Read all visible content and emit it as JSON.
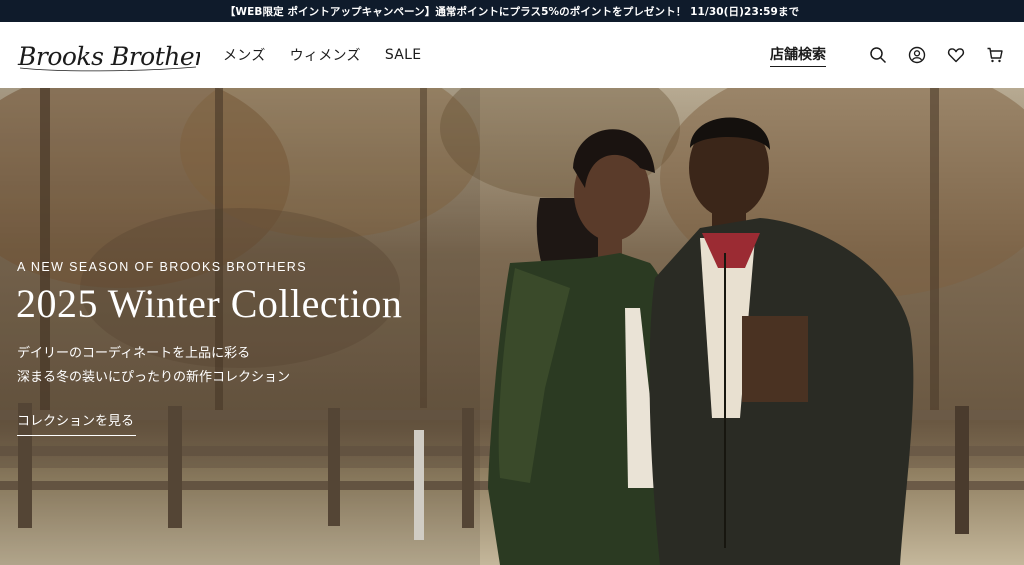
{
  "promo": {
    "text": "【WEB限定 ポイントアップキャンペーン】通常ポイントにプラス5%のポイントをプレゼント！ 11/30(日)23:59まで"
  },
  "header": {
    "logo_text": "Brooks Brothers",
    "nav": [
      {
        "label": "メンズ"
      },
      {
        "label": "ウィメンズ"
      },
      {
        "label": "SALE"
      }
    ],
    "store_locator": "店舗検索",
    "icons": [
      "search-icon",
      "account-icon",
      "wishlist-icon",
      "cart-icon"
    ]
  },
  "hero": {
    "eyebrow": "A NEW SEASON OF BROOKS BROTHERS",
    "headline": "2025 Winter Collection",
    "desc_line1": "デイリーのコーディネートを上品に彩る",
    "desc_line2": "深まる冬の装いにぴったりの新作コレクション",
    "cta": "コレクションを見る"
  },
  "colors": {
    "promo_bg": "#0f1b2b",
    "text_dark": "#1b1b1b",
    "hero_text": "#ffffff"
  }
}
